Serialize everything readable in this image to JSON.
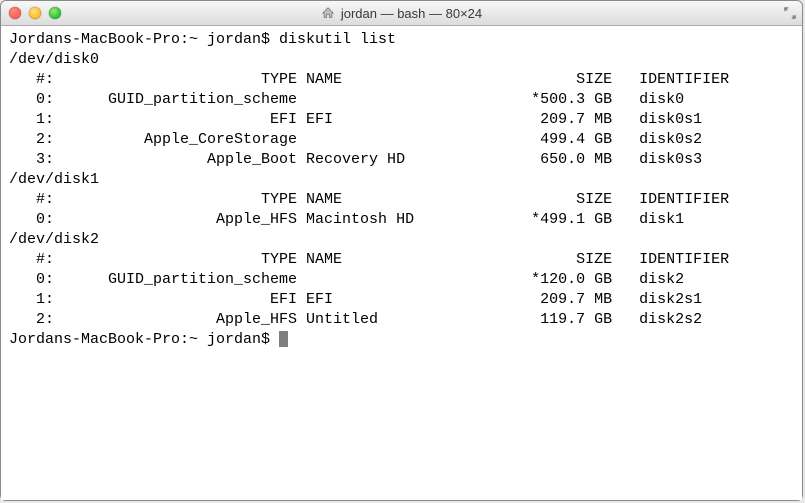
{
  "window": {
    "title": "jordan — bash — 80×24"
  },
  "session": {
    "prompt": "Jordans-MacBook-Pro:~ jordan$ ",
    "command": "diskutil list"
  },
  "disks": [
    {
      "device": "/dev/disk0",
      "header": {
        "num": "#:",
        "type": "TYPE",
        "name": "NAME",
        "size": "SIZE",
        "identifier": "IDENTIFIER"
      },
      "rows": [
        {
          "num": "0:",
          "type": "GUID_partition_scheme",
          "name": "",
          "size": "*500.3 GB",
          "identifier": "disk0"
        },
        {
          "num": "1:",
          "type": "EFI",
          "name": "EFI",
          "size": "209.7 MB",
          "identifier": "disk0s1"
        },
        {
          "num": "2:",
          "type": "Apple_CoreStorage",
          "name": "",
          "size": "499.4 GB",
          "identifier": "disk0s2"
        },
        {
          "num": "3:",
          "type": "Apple_Boot",
          "name": "Recovery HD",
          "size": "650.0 MB",
          "identifier": "disk0s3"
        }
      ]
    },
    {
      "device": "/dev/disk1",
      "header": {
        "num": "#:",
        "type": "TYPE",
        "name": "NAME",
        "size": "SIZE",
        "identifier": "IDENTIFIER"
      },
      "rows": [
        {
          "num": "0:",
          "type": "Apple_HFS",
          "name": "Macintosh HD",
          "size": "*499.1 GB",
          "identifier": "disk1"
        }
      ]
    },
    {
      "device": "/dev/disk2",
      "header": {
        "num": "#:",
        "type": "TYPE",
        "name": "NAME",
        "size": "SIZE",
        "identifier": "IDENTIFIER"
      },
      "rows": [
        {
          "num": "0:",
          "type": "GUID_partition_scheme",
          "name": "",
          "size": "*120.0 GB",
          "identifier": "disk2"
        },
        {
          "num": "1:",
          "type": "EFI",
          "name": "EFI",
          "size": "209.7 MB",
          "identifier": "disk2s1"
        },
        {
          "num": "2:",
          "type": "Apple_HFS",
          "name": "Untitled",
          "size": "119.7 GB",
          "identifier": "disk2s2"
        }
      ]
    }
  ]
}
